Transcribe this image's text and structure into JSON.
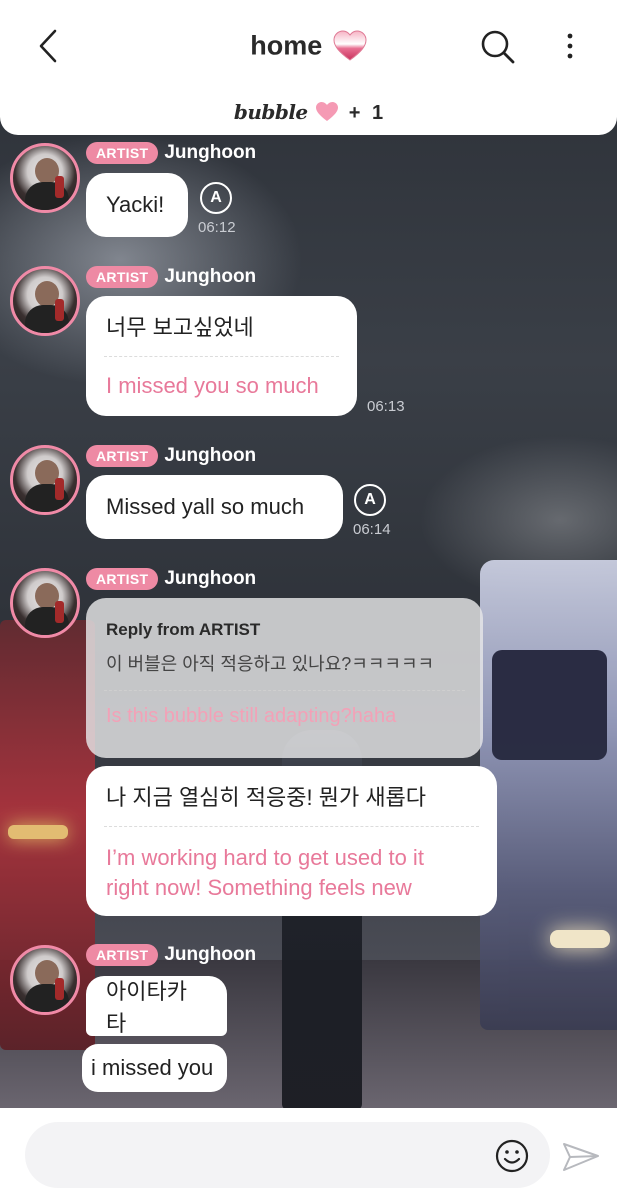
{
  "header": {
    "title": "home",
    "service_logo": "bubble",
    "plus": "+",
    "member_count": "1"
  },
  "messages": [
    {
      "badge": "ARTIST",
      "name": "Junghoon",
      "korean": "Yacki!",
      "time": "06:12",
      "translate_icon": "A"
    },
    {
      "badge": "ARTIST",
      "name": "Junghoon",
      "korean": "너무 보고싶었네",
      "english": "I missed you so much",
      "time": "06:13"
    },
    {
      "badge": "ARTIST",
      "name": "Junghoon",
      "korean": "Missed yall so much",
      "time": "06:14",
      "translate_icon": "A"
    },
    {
      "badge": "ARTIST",
      "name": "Junghoon",
      "reply_title": "Reply from ARTIST",
      "reply_korean": "이 버블은 아직 적응하고 있나요?ㅋㅋㅋㅋㅋ",
      "reply_english": "Is this bubble still adapting?haha",
      "korean": "나 지금 열심히 적응중! 뭔가 새롭다",
      "english_line1": "I’m working hard to get used to it",
      "english_line2": "right now! Something feels new"
    },
    {
      "badge": "ARTIST",
      "name": "Junghoon",
      "korean": "아이타카타",
      "english": "i missed you"
    }
  ],
  "icons": {
    "back": "chevron-left-icon",
    "title_heart": "heart-icon",
    "bubble_heart": "heart-icon",
    "search": "search-icon",
    "more": "more-vertical-icon",
    "translate": "translate-icon",
    "emoji": "smiley-icon",
    "send": "send-icon"
  },
  "colors": {
    "accent_pink": "#ee8aa4",
    "english_text": "#e8799a",
    "header_bg": "#ffffff"
  }
}
